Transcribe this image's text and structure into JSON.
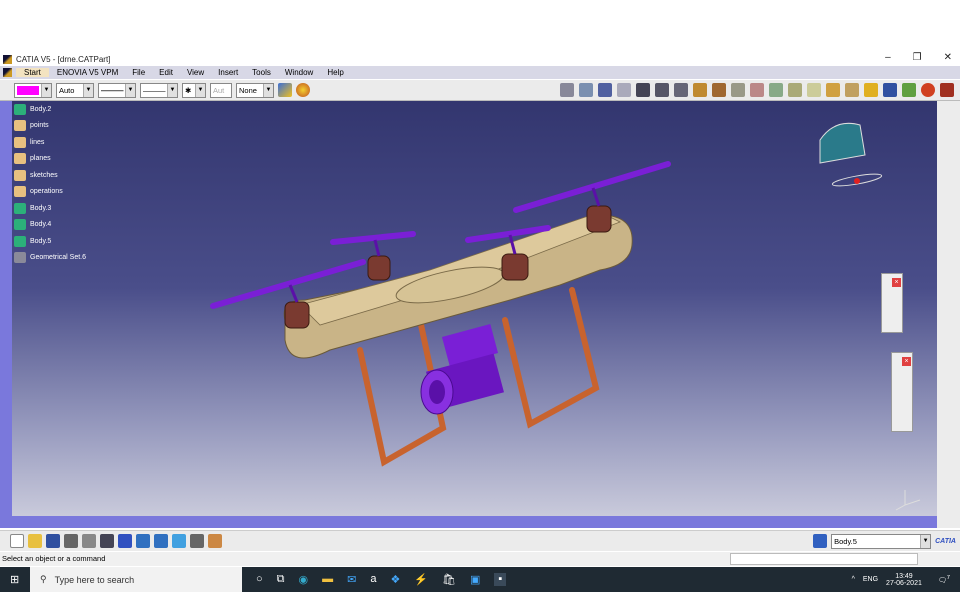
{
  "window": {
    "title": "CATIA V5 - [drne.CATPart]",
    "min": "–",
    "restore": "❐",
    "close": "✕"
  },
  "menu": [
    "Start",
    "ENOVIA V5 VPM",
    "File",
    "Edit",
    "View",
    "Insert",
    "Tools",
    "Window",
    "Help"
  ],
  "toolbar": {
    "color": "#ff00ff",
    "transparency": "Auto",
    "linetype": "———",
    "thickness": "———",
    "point": "✱",
    "layer_disabled": "Aut",
    "layer": "None"
  },
  "tree": [
    {
      "label": "Body.2",
      "type": "body"
    },
    {
      "label": "points",
      "type": "set"
    },
    {
      "label": "lines",
      "type": "set"
    },
    {
      "label": "planes",
      "type": "set"
    },
    {
      "label": "sketches",
      "type": "set"
    },
    {
      "label": "operations",
      "type": "set"
    },
    {
      "label": "Body.3",
      "type": "body"
    },
    {
      "label": "Body.4",
      "type": "body"
    },
    {
      "label": "Body.5",
      "type": "body"
    },
    {
      "label": "Geometrical Set.6",
      "type": "geoset"
    }
  ],
  "bottom": {
    "current_body": "Body.5",
    "brand": "CATIA"
  },
  "status": {
    "message": "Select an object or a command"
  },
  "taskbar": {
    "search_placeholder": "Type here to search",
    "lang": "ENG",
    "time": "13:49",
    "date": "27-06-2021",
    "notifications": "7"
  },
  "colors": {
    "prop": "#7a1fd6",
    "body": "#c9b487",
    "legs": "#c8632e",
    "motor": "#7a3a30",
    "viewport_top": "#33366f",
    "viewport_bottom": "#c9cadb"
  }
}
